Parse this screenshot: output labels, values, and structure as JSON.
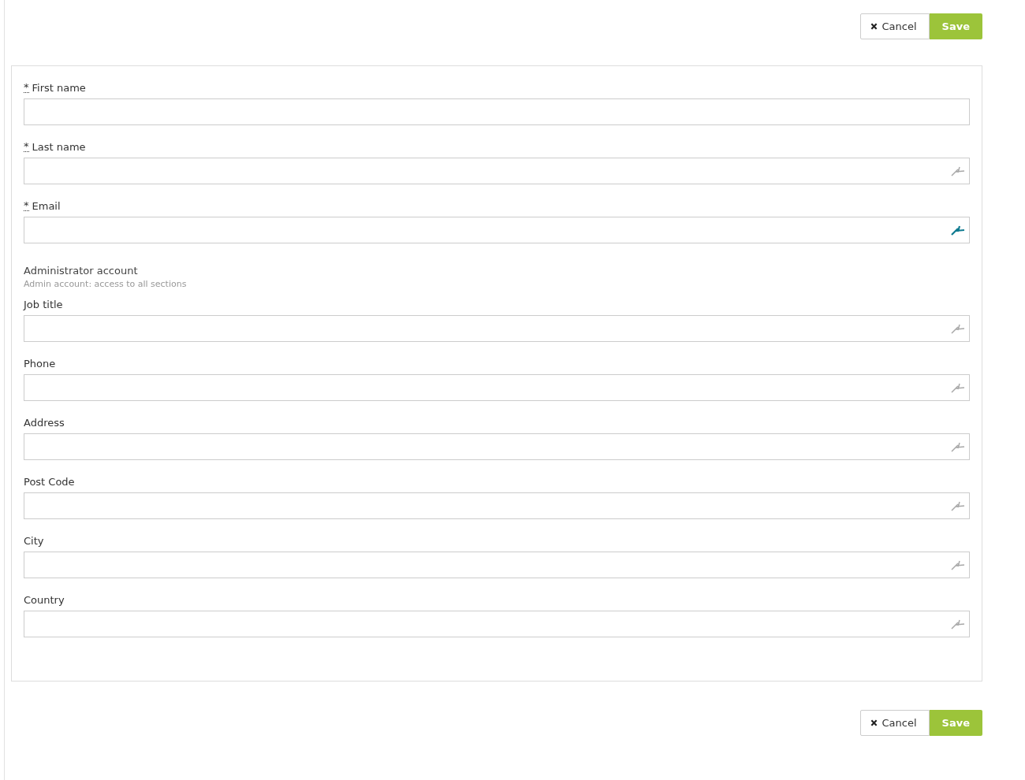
{
  "top_actions": {
    "cancel": "Cancel",
    "save": "Save"
  },
  "form": [
    {
      "kind": "input",
      "label": "First name",
      "required_mark": "*"
    },
    {
      "kind": "input",
      "label": "Last name",
      "required_mark": "*",
      "tool": true,
      "active": false
    },
    {
      "kind": "input",
      "label": "Email",
      "required_mark": "*",
      "tool": true,
      "active": true
    },
    {
      "kind": "note",
      "title": "Administrator account",
      "hint": "Admin account: access to all sections"
    },
    {
      "kind": "input",
      "label": "Job title",
      "tool": true,
      "active": false
    },
    {
      "kind": "input",
      "label": "Phone",
      "tool": true,
      "active": false
    },
    {
      "kind": "input",
      "label": "Address",
      "tool": true,
      "active": false
    },
    {
      "kind": "input",
      "label": "Post Code",
      "tool": true,
      "active": false
    },
    {
      "kind": "input",
      "label": "City",
      "tool": true,
      "active": false
    },
    {
      "kind": "input",
      "label": "Country",
      "tool": true,
      "active": false
    }
  ],
  "bottom_actions": {
    "cancel": "Cancel",
    "save": "Save"
  }
}
